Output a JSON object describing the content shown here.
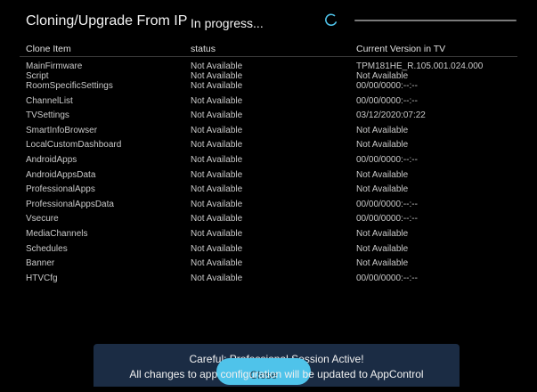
{
  "header": {
    "title": "Cloning/Upgrade From IP",
    "status_text": "In progress...",
    "progress": 0
  },
  "table": {
    "columns": [
      "Clone Item",
      "status",
      "Current Version in TV"
    ],
    "rows": [
      {
        "item": "MainFirmware",
        "status": "Not Available",
        "version": "TPM181HE_R.105.001.024.000"
      },
      {
        "item": "Script",
        "status": "Not Available",
        "version": "Not Available"
      },
      {
        "item": "RoomSpecificSettings",
        "status": "Not Available",
        "version": "00/00/0000:--:--"
      },
      {
        "item": "ChannelList",
        "status": "Not Available",
        "version": "00/00/0000:--:--"
      },
      {
        "item": "TVSettings",
        "status": "Not Available",
        "version": "03/12/2020:07:22"
      },
      {
        "item": "SmartInfoBrowser",
        "status": "Not Available",
        "version": "Not Available"
      },
      {
        "item": "LocalCustomDashboard",
        "status": "Not Available",
        "version": "Not Available"
      },
      {
        "item": "AndroidApps",
        "status": "Not Available",
        "version": "00/00/0000:--:--"
      },
      {
        "item": "AndroidAppsData",
        "status": "Not Available",
        "version": "Not Available"
      },
      {
        "item": "ProfessionalApps",
        "status": "Not Available",
        "version": "Not Available"
      },
      {
        "item": "ProfessionalAppsData",
        "status": "Not Available",
        "version": "00/00/0000:--:--"
      },
      {
        "item": "Vsecure",
        "status": "Not Available",
        "version": "00/00/0000:--:--"
      },
      {
        "item": "MediaChannels",
        "status": "Not Available",
        "version": "Not Available"
      },
      {
        "item": "Schedules",
        "status": "Not Available",
        "version": "Not Available"
      },
      {
        "item": "Banner",
        "status": "Not Available",
        "version": "Not Available"
      },
      {
        "item": "HTVCfg",
        "status": "Not Available",
        "version": "00/00/0000:--:--"
      }
    ]
  },
  "toast": {
    "line1": "Careful: Professional Session Active!",
    "line2": "All changes to app configuration will be updated to AppControl"
  },
  "close_button": {
    "label": "Close"
  },
  "colors": {
    "background": "#000000",
    "toast": "#1b2c44",
    "button": "#4fc3ea"
  }
}
